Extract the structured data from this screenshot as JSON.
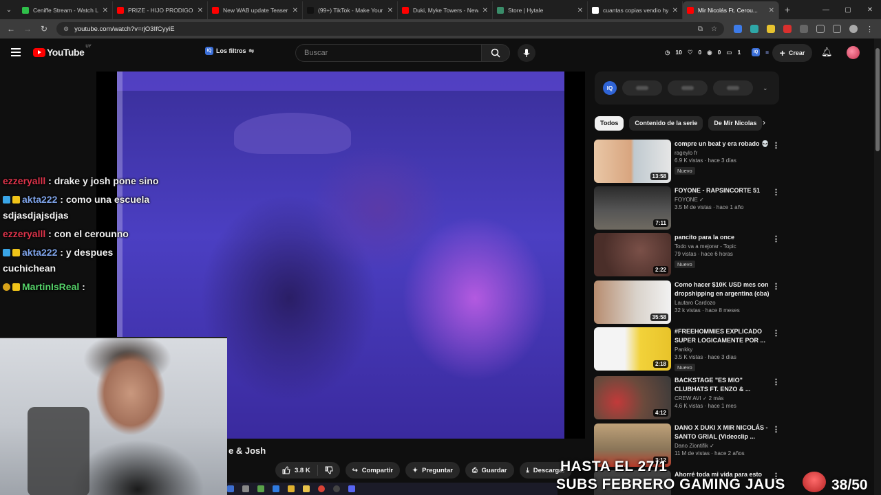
{
  "browser": {
    "tabs": [
      {
        "title": "Ceniffe Stream - Watch Li...",
        "color": "#2fbf4a"
      },
      {
        "title": "PRIZE - HIJO PRODIGO (L...",
        "color": "#ff0000"
      },
      {
        "title": "New WAB update Teaser",
        "color": "#ff0000"
      },
      {
        "title": "(99+) TikTok - Make Your D...",
        "color": "#111111"
      },
      {
        "title": "Duki, Myke Towers - New...",
        "color": "#ff0000"
      },
      {
        "title": "Store | Hytale",
        "color": "#3a8d6a"
      },
      {
        "title": "cuantas copias vendio hy...",
        "color": "#ffffff"
      },
      {
        "title": "Mir Nicolás Ft. Cerou...",
        "color": "#ff0000"
      }
    ],
    "url": "youtube.com/watch?v=rjO3IfCyyiE"
  },
  "youtube": {
    "logo_text": "YouTube",
    "country": "UY",
    "filters_label": "Los filtros",
    "search_placeholder": "Buscar",
    "stats": {
      "a": "10",
      "b": "0",
      "c": "0",
      "d": "1"
    },
    "create_label": "Crear"
  },
  "chat": [
    {
      "user": "ezzeryalll",
      "text": ": drake y josh pone sino",
      "color": "red",
      "badges": []
    },
    {
      "user": "akta222",
      "text": ": como una escuela sdjasdjajsdjas",
      "color": "blue",
      "badges": [
        "cube",
        "crown"
      ]
    },
    {
      "user": "ezzeryalll",
      "text": ": con el cerounno",
      "color": "red",
      "badges": []
    },
    {
      "user": "akta222",
      "text": ": y despues cuchichean",
      "color": "blue",
      "badges": [
        "cube",
        "crown"
      ]
    },
    {
      "user": "MartinIsReal",
      "text": ":",
      "color": "green",
      "badges": [
        "leaf",
        "crown"
      ]
    }
  ],
  "video": {
    "title_fragment": "e & Josh",
    "likes": "3.8 K",
    "share_label": "Compartir",
    "ask_label": "Preguntar",
    "save_label": "Guardar",
    "download_label": "Descargar"
  },
  "sidebar": {
    "chips": [
      "Todos",
      "Contenido de la serie",
      "De Mir Nicolas"
    ],
    "recommendations": [
      {
        "title": "compre un beat y era robado 💀",
        "channel": "rageylo fr",
        "meta": "6.9 K vistas · hace 3 días",
        "duration": "13:58",
        "new": "Nuevo",
        "thumb": "linear-gradient(90deg,#e9c7a6 0%,#d8a57f 48%,#bfc9cf 52%,#e6e6e6 100%)"
      },
      {
        "title": "FOYONE - RAPSINCORTE 51",
        "channel": "FOYONE ✓",
        "meta": "3.5 M de vistas · hace 1 año",
        "duration": "7:11",
        "new": "",
        "thumb": "linear-gradient(180deg,#2a2a2a 0%,#555 55%,#6f6a61 100%)"
      },
      {
        "title": "pancito para la once",
        "channel": "Todo va a mejorar - Topic",
        "meta": "79 vistas · hace 6 horas",
        "duration": "2:22",
        "new": "Nuevo",
        "thumb": "radial-gradient(circle at 60% 40%,#7a5048 0%,#4a2e29 70%)"
      },
      {
        "title": "Como hacer $10K USD mes con dropshipping en argentina (cba)",
        "channel": "Lautaro Cardozo",
        "meta": "32 k vistas · hace 8 meses",
        "duration": "35:58",
        "new": "",
        "thumb": "linear-gradient(90deg,#b78c6f 0%,#d9d2ca 55%,#f2f2f2 100%)"
      },
      {
        "title": "#FREEHOMMIES EXPLICADO SUPER LOGICAMENTE POR ...",
        "channel": "Pankky",
        "meta": "3.5 K vistas · hace 3 días",
        "duration": "2:18",
        "new": "Nuevo",
        "thumb": "linear-gradient(90deg,#f4f4f4 0%,#f4f4f4 40%,#f2d23a 60%,#e8c32a 100%)"
      },
      {
        "title": "BACKSTAGE \"ES MIO\" CLUBHATS FT. ENZO & ...",
        "channel": "CREW AVI ✓ 2 más",
        "meta": "4.6 K vistas · hace 1 mes",
        "duration": "4:12",
        "new": "",
        "thumb": "radial-gradient(circle at 30% 60%,#c23a3a 0%,#6b4a3c 45%,#3a3a3a 100%)"
      },
      {
        "title": "DANO X DUKI X MIR NICOLÁS - SANTO GRIAL (Videoclip ...",
        "channel": "Dano Ziontifik ✓",
        "meta": "11 M de vistas · hace 2 años",
        "duration": "3:12",
        "new": "",
        "thumb": "linear-gradient(180deg,#bfa27a 0%,#8a7558 60%,#b43a2a 100%)"
      },
      {
        "title": "Ahorré toda mi vida para esto",
        "channel": "",
        "meta": "",
        "duration": "",
        "new": "",
        "thumb": "linear-gradient(180deg,#444 0%,#222 100%)"
      }
    ]
  },
  "overlay": {
    "line1": "HASTA EL 27/1",
    "line2": "SUBS FEBRERO GAMING JAUS",
    "count": "38/50"
  }
}
